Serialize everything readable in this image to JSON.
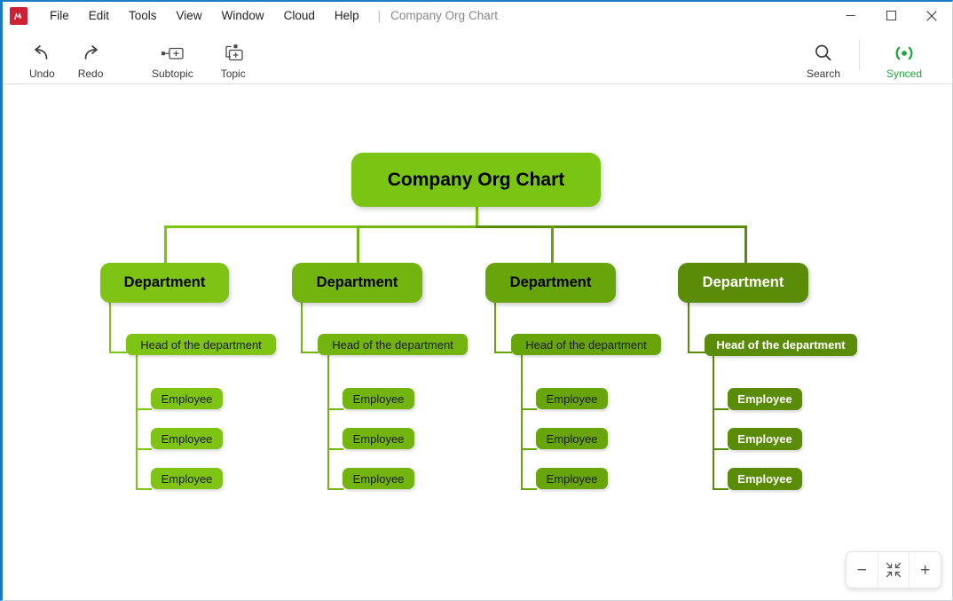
{
  "window": {
    "app_icon": "mindmaster-logo-icon",
    "document_title": "Company Org Chart",
    "menu": [
      {
        "label": "File",
        "name": "menu-file"
      },
      {
        "label": "Edit",
        "name": "menu-edit"
      },
      {
        "label": "Tools",
        "name": "menu-tools"
      },
      {
        "label": "View",
        "name": "menu-view"
      },
      {
        "label": "Window",
        "name": "menu-window"
      },
      {
        "label": "Cloud",
        "name": "menu-cloud"
      },
      {
        "label": "Help",
        "name": "menu-help"
      }
    ],
    "separator": "|",
    "controls": {
      "minimize": "minimize-icon",
      "maximize": "maximize-icon",
      "close": "close-icon"
    }
  },
  "toolbar": {
    "left": [
      {
        "label": "Undo",
        "icon": "undo-arrow-icon",
        "name": "toolbar-undo"
      },
      {
        "label": "Redo",
        "icon": "redo-arrow-icon",
        "name": "toolbar-redo"
      },
      {
        "label": "Subtopic",
        "icon": "subtopic-icon",
        "name": "toolbar-subtopic"
      },
      {
        "label": "Topic",
        "icon": "topic-icon",
        "name": "toolbar-topic"
      }
    ],
    "right": [
      {
        "label": "Search",
        "icon": "search-icon",
        "name": "toolbar-search"
      },
      {
        "label": "Synced",
        "icon": "cloud-synced-icon",
        "name": "toolbar-synced"
      }
    ]
  },
  "zoom_controls": {
    "zoom_out": "−",
    "fit_to_screen": "fit-screen-icon",
    "zoom_in": "+"
  },
  "colors": {
    "root": "#7ac414",
    "branch_1": "#7fc314",
    "branch_2": "#73b40e",
    "branch_3": "#67a50a",
    "branch_4": "#5a8c08",
    "accent_blue": "#1a7bc4",
    "sync_green": "#1ea83c",
    "logo_red": "#cf2135"
  },
  "chart_data": {
    "type": "org-chart",
    "root": {
      "label": "Company Org Chart",
      "color": "#7ac414",
      "text_color": "#000000"
    },
    "branches": [
      {
        "department": {
          "label": "Department",
          "color": "#7fc314",
          "text_color": "#000000"
        },
        "head": {
          "label": "Head of the department",
          "color": "#7fc314",
          "text_color": "#1a1a1a"
        },
        "employees": [
          {
            "label": "Employee",
            "color": "#7fc314",
            "text_color": "#1a1a1a"
          },
          {
            "label": "Employee",
            "color": "#7fc314",
            "text_color": "#1a1a1a"
          },
          {
            "label": "Employee",
            "color": "#7fc314",
            "text_color": "#1a1a1a"
          }
        ]
      },
      {
        "department": {
          "label": "Department",
          "color": "#73b40e",
          "text_color": "#000000"
        },
        "head": {
          "label": "Head of the department",
          "color": "#73b40e",
          "text_color": "#1a1a1a"
        },
        "employees": [
          {
            "label": "Employee",
            "color": "#73b40e",
            "text_color": "#1a1a1a"
          },
          {
            "label": "Employee",
            "color": "#73b40e",
            "text_color": "#1a1a1a"
          },
          {
            "label": "Employee",
            "color": "#73b40e",
            "text_color": "#1a1a1a"
          }
        ]
      },
      {
        "department": {
          "label": "Department",
          "color": "#67a50a",
          "text_color": "#000000"
        },
        "head": {
          "label": "Head of the department",
          "color": "#67a50a",
          "text_color": "#1a1a1a"
        },
        "employees": [
          {
            "label": "Employee",
            "color": "#67a50a",
            "text_color": "#1a1a1a"
          },
          {
            "label": "Employee",
            "color": "#67a50a",
            "text_color": "#1a1a1a"
          },
          {
            "label": "Employee",
            "color": "#67a50a",
            "text_color": "#1a1a1a"
          }
        ]
      },
      {
        "department": {
          "label": "Department",
          "color": "#5a8c08",
          "text_color": "#ffffff"
        },
        "head": {
          "label": "Head of the department",
          "color": "#5a8c08",
          "text_color": "#ffffff"
        },
        "employees": [
          {
            "label": "Employee",
            "color": "#5a8c08",
            "text_color": "#ffffff"
          },
          {
            "label": "Employee",
            "color": "#5a8c08",
            "text_color": "#ffffff"
          },
          {
            "label": "Employee",
            "color": "#5a8c08",
            "text_color": "#ffffff"
          }
        ]
      }
    ]
  }
}
